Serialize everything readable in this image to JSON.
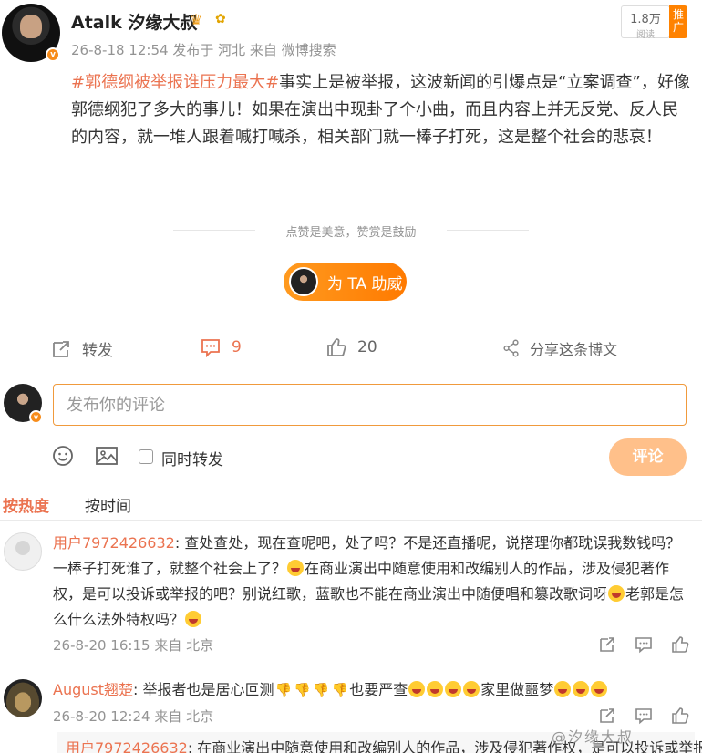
{
  "post": {
    "author": "Atalk 汐缘大叔",
    "verified_badge": "v",
    "timestamp": "26-8-18 12:54",
    "location": "发布于 河北",
    "source": "来自 微博搜索",
    "reads_count": "1.8万",
    "reads_label": "阅读",
    "push_label": "推广",
    "hashtag": "#郭德纲被举报谁压力最大#",
    "body": "事实上是被举报，这波新闻的引爆点是“立案调查”，好像郭德纲犯了多大的事儿！如果在演出中现卦了个小曲，而且内容上并无反党、反人民的内容，就一堆人跟着喊打喊杀，相关部门就一棒子打死，这是整个社会的悲哀！",
    "like_hint": "点赞是美意，赞赏是鼓励",
    "boost_label": "为 TA 助威"
  },
  "actions": {
    "repost_label": "转发",
    "comment_count": "9",
    "like_count": "20",
    "share_label": "分享这条博文"
  },
  "composer": {
    "placeholder": "发布你的评论",
    "repost_check_label": "同时转发",
    "submit_label": "评论"
  },
  "sort": {
    "hot": "按热度",
    "time": "按时间"
  },
  "comments": [
    {
      "user": "用户7972426632",
      "text_1": "查处查处，现在查呢吧，处了吗？不是还直播呢，说搭理你都耽误我数钱吗？一棒子打死谁了，就整个社会上了？",
      "text_2": "在商业演出中随意使用和改编别人的作品，涉及侵犯著作权，是可以投诉或举报的吧？别说红歌，蓝歌也不能在商业演出中随便唱和篡改歌词呀",
      "text_3": "老郭是怎么什么法外特权吗？",
      "time": "26-8-20 16:15",
      "location": "来自 北京"
    },
    {
      "user": "August翘楚",
      "text_1": "举报者也是居心叵测",
      "text_2": "也要严查",
      "text_3": "家里做噩梦",
      "time": "26-8-20 12:24",
      "location": "来自 北京"
    }
  ],
  "reply_preview": {
    "user": "用户7972426632",
    "text": "在商业演出中随意使用和改编别人的作品，涉及侵犯著作权，是可以投诉或举报"
  },
  "watermark": "@汐缘大叔",
  "colors": {
    "accent": "#eb7350",
    "brand_orange": "#ff8200",
    "meta_gray": "#939393"
  }
}
